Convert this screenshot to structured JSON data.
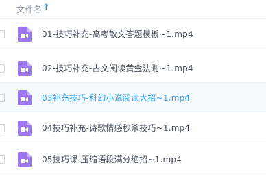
{
  "header": {
    "name_label": "文件名",
    "sort_icon": "sort-ascending-icon",
    "sort_glyph": "↑"
  },
  "colors": {
    "accent": "#2ea3f0",
    "video_icon": "#9d76f0",
    "selected_row_bg": "#f5fafe"
  },
  "files": [
    {
      "name": "01-技巧补充-高考散文答题模板~1.mp4",
      "icon": "video-file-icon",
      "selected": false
    },
    {
      "name": "02-技巧补充-古文阅读黄金法则~1.mp4",
      "icon": "video-file-icon",
      "selected": false
    },
    {
      "name": "03补充技巧-科幻小说阅读大招~1.mp4",
      "icon": "video-file-icon",
      "selected": true
    },
    {
      "name": "04技巧补充-诗歌情感秒杀技巧~1.mp4",
      "icon": "video-file-icon",
      "selected": false
    },
    {
      "name": "05技巧课-压缩语段满分绝招~1.mp4",
      "icon": "video-file-icon",
      "selected": false
    }
  ]
}
